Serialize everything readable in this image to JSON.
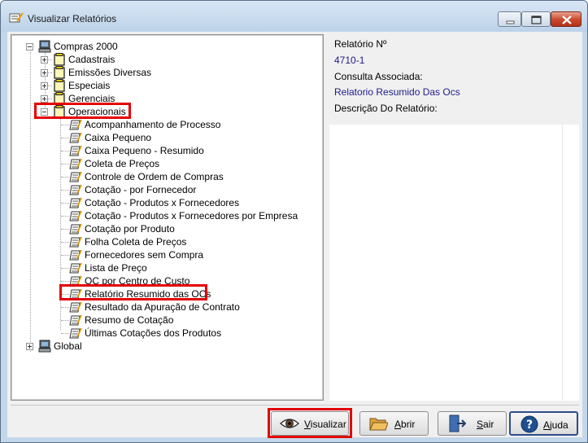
{
  "window": {
    "title": "Visualizar Relatórios"
  },
  "tree": {
    "root": "Compras 2000",
    "groups": [
      {
        "label": "Cadastrais"
      },
      {
        "label": "Emissões Diversas"
      },
      {
        "label": "Especiais"
      },
      {
        "label": "Gerenciais"
      },
      {
        "label": "Operacionais"
      }
    ],
    "reports": [
      "Acompanhamento de Processo",
      "Caixa Pequeno",
      "Caixa Pequeno - Resumido",
      "Coleta de Preços",
      "Controle de Ordem de Compras",
      "Cotação - por Fornecedor",
      "Cotação - Produtos x Fornecedores",
      "Cotação - Produtos x Fornecedores por Empresa",
      "Cotação por Produto",
      "Folha Coleta de Preços",
      "Fornecedores sem Compra",
      "Lista de Preço",
      "OC por Centro de Custo",
      "Relatório Resumido das OCs",
      "Resultado da Apuração de Contrato",
      "Resumo de Cotação",
      "Últimas Cotações dos Produtos"
    ],
    "global": "Global",
    "selected_report": "Relatório Resumido das OCs"
  },
  "details": {
    "report_no_label": "Relatório Nº",
    "report_no_value": "4710-1",
    "query_label": "Consulta Associada:",
    "query_value": "Relatorio Resumido Das Ocs",
    "description_label": "Descrição Do Relatório:",
    "description_value": ""
  },
  "buttons": {
    "visualizar": "Visualizar",
    "abrir": "Abrir",
    "sair": "Sair",
    "ajuda": "Ajuda"
  },
  "colors": {
    "highlight": "#e40000",
    "link_value": "#1c1c8c"
  }
}
